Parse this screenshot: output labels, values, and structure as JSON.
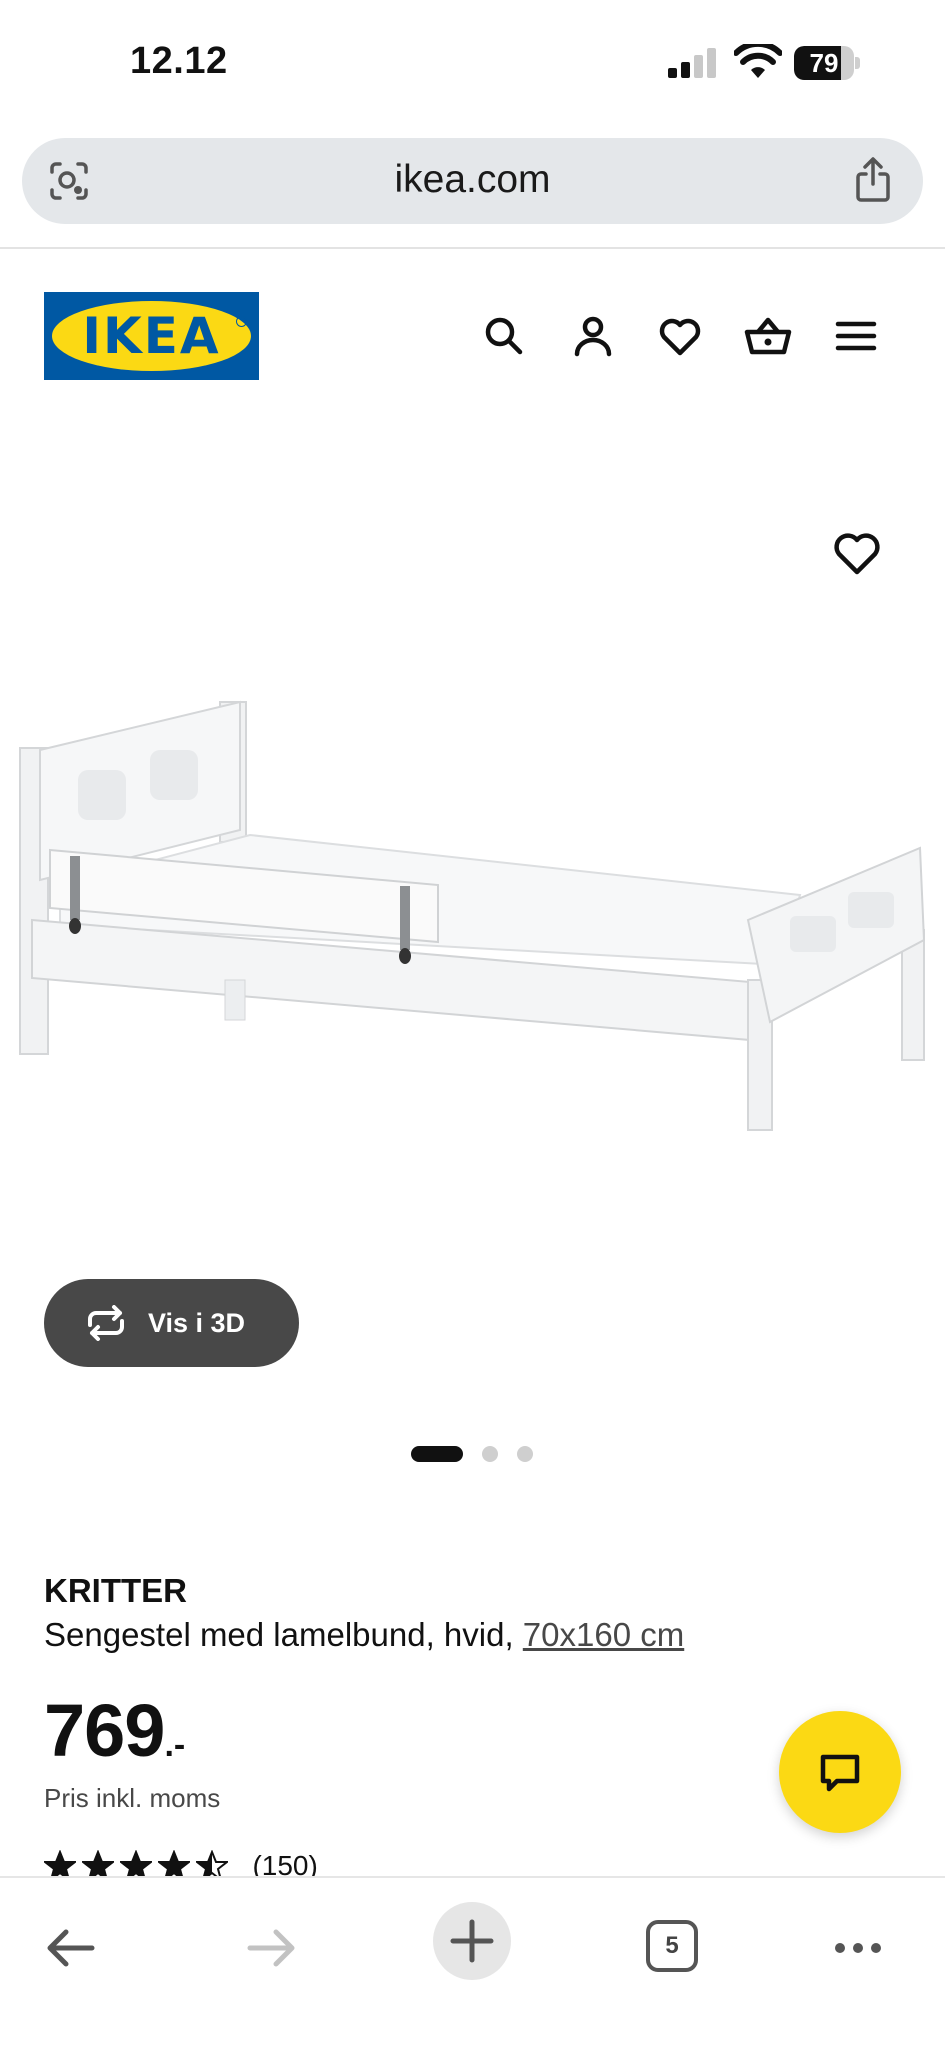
{
  "status_bar": {
    "time": "12.12",
    "battery_level": "79"
  },
  "browser": {
    "url": "ikea.com",
    "tab_count": "5"
  },
  "header": {
    "logo_text": "IKEA",
    "icons": [
      "search-icon",
      "account-icon",
      "heart-icon",
      "basket-icon",
      "menu-icon"
    ]
  },
  "product": {
    "name": "KRITTER",
    "description": "Sengestel med lamelbund, hvid,",
    "size": "70x160 cm",
    "price": "769",
    "price_suffix": ".-",
    "price_note": "Pris inkl. moms",
    "rating": 4.5,
    "rating_count": "(150)",
    "view_3d_label": "Vis i 3D",
    "image_count": 3,
    "active_image": 1
  },
  "colors": {
    "ikea_blue": "#0058a3",
    "ikea_yellow": "#fbd914",
    "button_dark": "#484848"
  }
}
